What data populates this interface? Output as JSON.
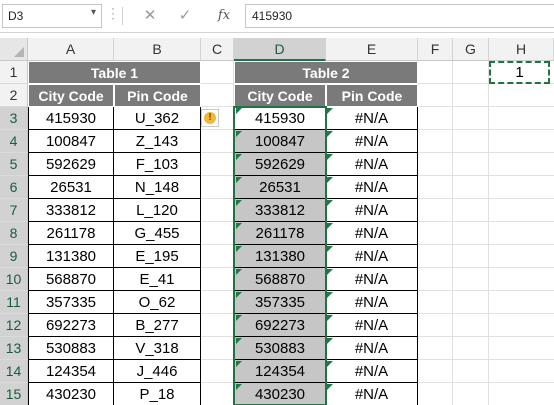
{
  "formula_bar": {
    "name_box": "D3",
    "name_box_dropdown": "▾",
    "cancel_icon": "✕",
    "enter_icon": "✓",
    "fx_label": "fx",
    "formula_value": "415930"
  },
  "columns": [
    "A",
    "B",
    "C",
    "D",
    "E",
    "F",
    "G",
    "H"
  ],
  "rows": [
    "1",
    "2",
    "3",
    "4",
    "5",
    "6",
    "7",
    "8",
    "9",
    "10",
    "11",
    "12",
    "13",
    "14",
    "15"
  ],
  "table1": {
    "title": "Table 1",
    "headers": [
      "City Code",
      "Pin Code"
    ],
    "city_codes": [
      "415930",
      "100847",
      "592629",
      "26531",
      "333812",
      "261178",
      "131380",
      "568870",
      "357335",
      "692273",
      "530883",
      "124354",
      "430230"
    ],
    "pin_codes": [
      "U_362",
      "Z_143",
      "F_103",
      "N_148",
      "L_120",
      "G_455",
      "E_195",
      "E_41",
      "O_62",
      "B_277",
      "V_318",
      "J_446",
      "P_18"
    ]
  },
  "table2": {
    "title": "Table 2",
    "headers": [
      "City Code",
      "Pin Code"
    ],
    "city_codes": [
      "415930",
      "100847",
      "592629",
      "26531",
      "333812",
      "261178",
      "131380",
      "568870",
      "357335",
      "692273",
      "530883",
      "124354",
      "430230"
    ],
    "pin_codes": [
      "#N/A",
      "#N/A",
      "#N/A",
      "#N/A",
      "#N/A",
      "#N/A",
      "#N/A",
      "#N/A",
      "#N/A",
      "#N/A",
      "#N/A",
      "#N/A",
      "#N/A"
    ]
  },
  "h1_value": "1",
  "warning_icon_glyph": "!",
  "colors": {
    "header_fill": "#7a7a7a",
    "shaded_fill": "#c6c6c6",
    "excel_green": "#217346"
  }
}
